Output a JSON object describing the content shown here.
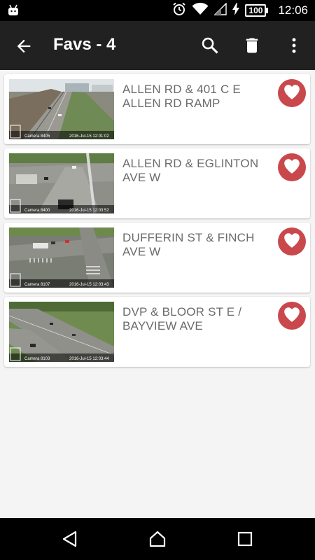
{
  "status_bar": {
    "time": "12:06",
    "battery": "100"
  },
  "toolbar": {
    "title": "Favs - 4"
  },
  "cameras": [
    {
      "title": "ALLEN RD & 401 C E ALLEN RD RAMP",
      "camera_label": "Camera 8405",
      "timestamp": "2016-Jul-15 12:01:02"
    },
    {
      "title": "ALLEN RD & EGLINTON AVE W",
      "camera_label": "Camera 8400",
      "timestamp": "2016-Jul-15 12:03:52"
    },
    {
      "title": "DUFFERIN ST & FINCH AVE W",
      "camera_label": "Camera 8107",
      "timestamp": "2016-Jul-15 12:03:43"
    },
    {
      "title": "DVP & BLOOR ST E / BAYVIEW AVE",
      "camera_label": "Camera 8103",
      "timestamp": "2016-Jul-15 12:03:44"
    }
  ],
  "colors": {
    "toolbar": "#212121",
    "favorite": "#c9484c",
    "title_text": "#6b6b6b",
    "background": "#f4f4f4"
  },
  "icons": {
    "toolbar": [
      "back-arrow-icon",
      "search-icon",
      "trash-icon",
      "more-vert-icon"
    ],
    "card": "heart-icon",
    "nav": [
      "nav-back-icon",
      "nav-home-icon",
      "nav-recents-icon"
    ]
  }
}
